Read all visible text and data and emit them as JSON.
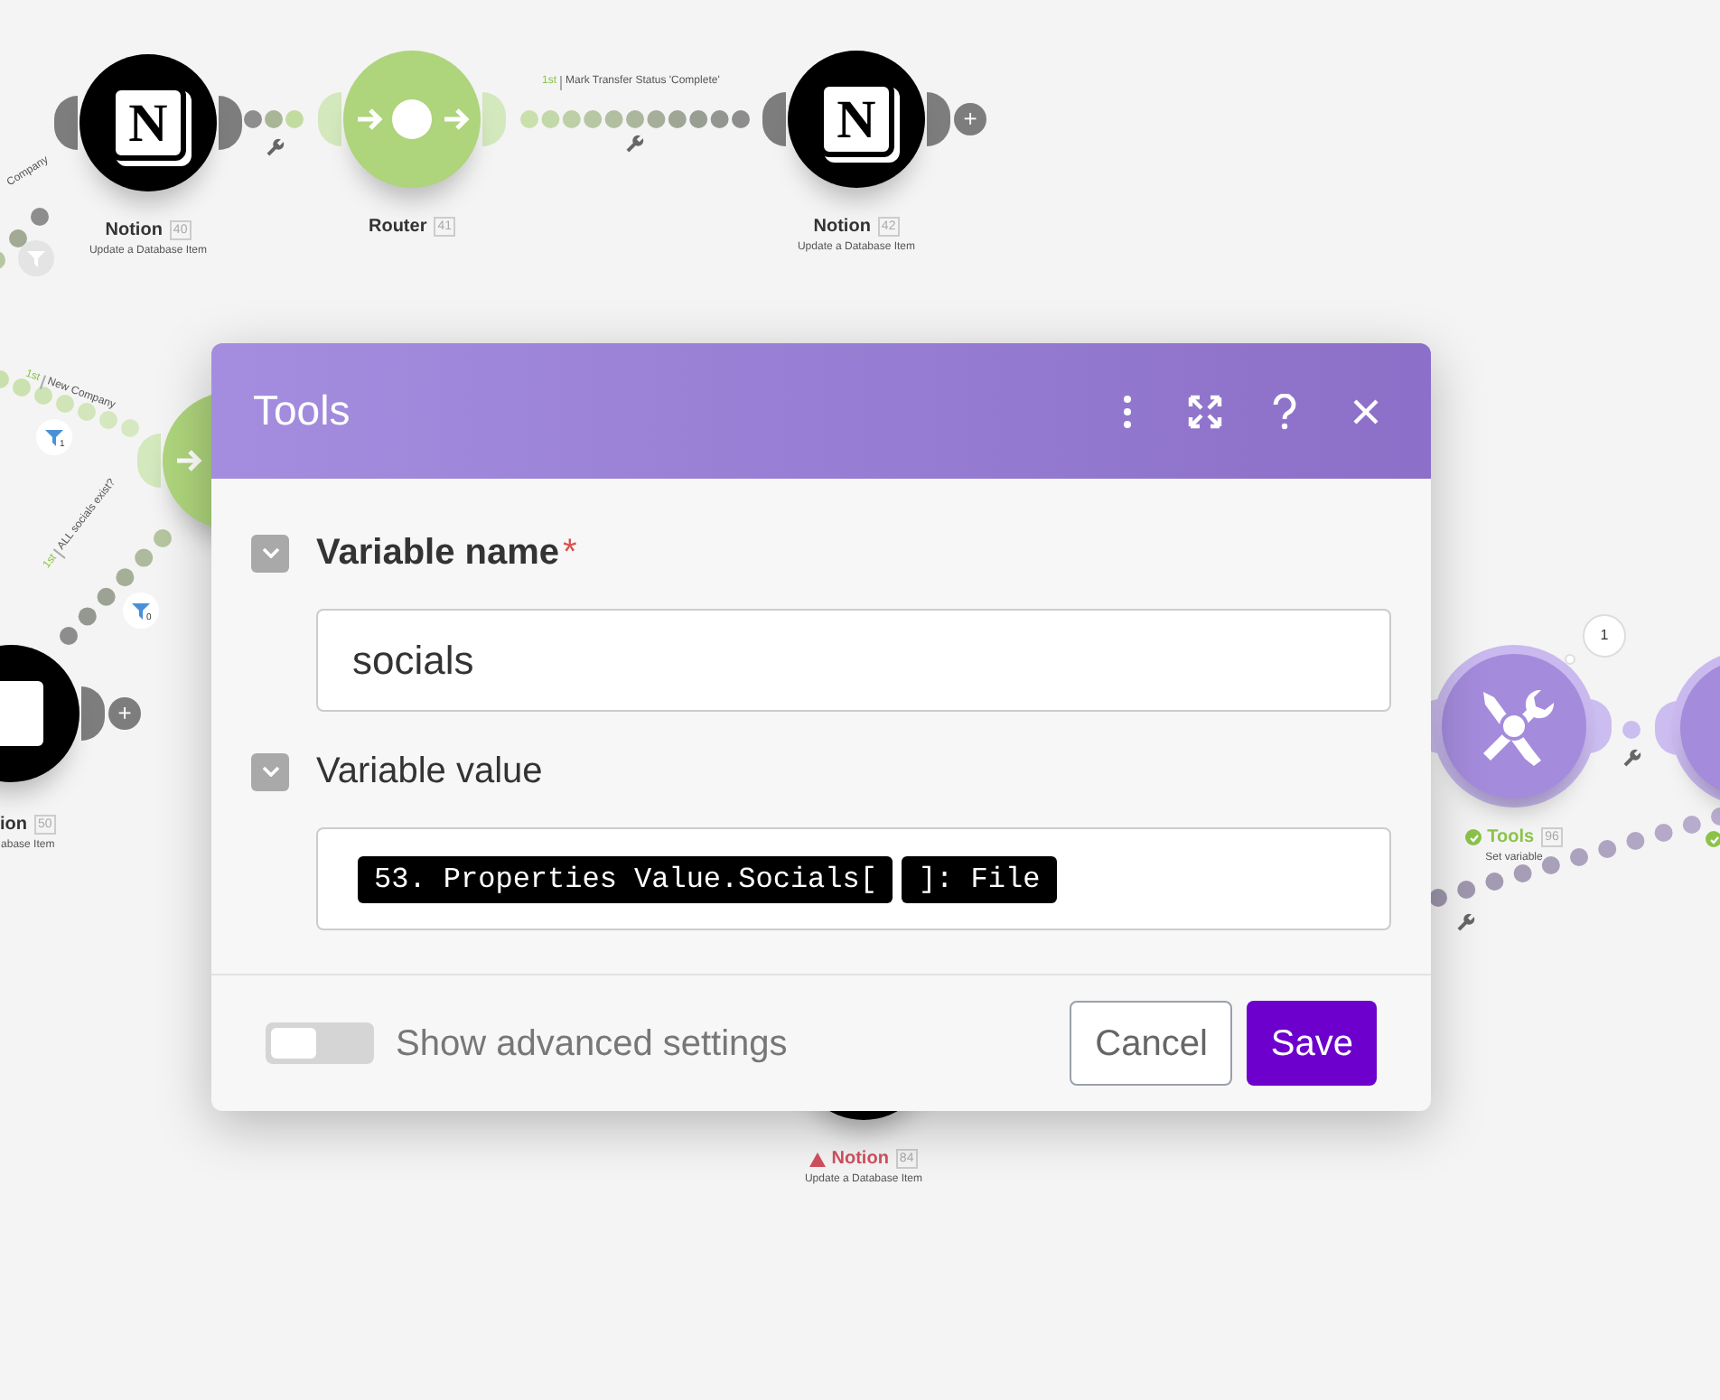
{
  "canvas": {
    "nodes": [
      {
        "kind": "notion",
        "icon_text": "N",
        "title": "Notion",
        "number": "40",
        "subtitle": "Update a Database Item"
      },
      {
        "kind": "router",
        "title": "Router",
        "number": "41"
      },
      {
        "kind": "notion",
        "icon_text": "N",
        "title": "Notion",
        "number": "42",
        "subtitle": "Update a Database Item",
        "add": "+"
      },
      {
        "kind": "router"
      },
      {
        "kind": "notion",
        "title": "ion",
        "number": "50",
        "subtitle": "abase Item",
        "add": "+"
      },
      {
        "kind": "tools",
        "title": "Tools",
        "number": "96",
        "subtitle": "Set variable",
        "success": true,
        "bubble": "1"
      },
      {
        "kind": "tools",
        "success": true
      },
      {
        "kind": "notion",
        "title": "Notion",
        "number": "84",
        "subtitle": "Update a Database Item",
        "warning": true
      }
    ],
    "routes": [
      {
        "order": "1st",
        "label": "Mark Transfer Status 'Complete'"
      },
      {
        "label": "Company"
      },
      {
        "order": "1st",
        "label": "New Company"
      },
      {
        "order": "1st",
        "label": "ALL socials exist?"
      }
    ],
    "filters": [
      {
        "active": false
      },
      {
        "active": true,
        "count": "1"
      },
      {
        "active": true,
        "count": "0"
      }
    ]
  },
  "dialog": {
    "title": "Tools",
    "fields": [
      {
        "label": "Variable name",
        "required_mark": "*",
        "expanded": true,
        "value": "socials"
      },
      {
        "label": "Variable value",
        "expanded": true,
        "tokens": [
          "53. Properties Value.Socials[",
          "]: File"
        ]
      }
    ],
    "advanced": {
      "label": "Show advanced settings",
      "on": false
    },
    "buttons": [
      {
        "label": "Cancel",
        "kind": "secondary"
      },
      {
        "label": "Save",
        "kind": "primary"
      }
    ]
  }
}
